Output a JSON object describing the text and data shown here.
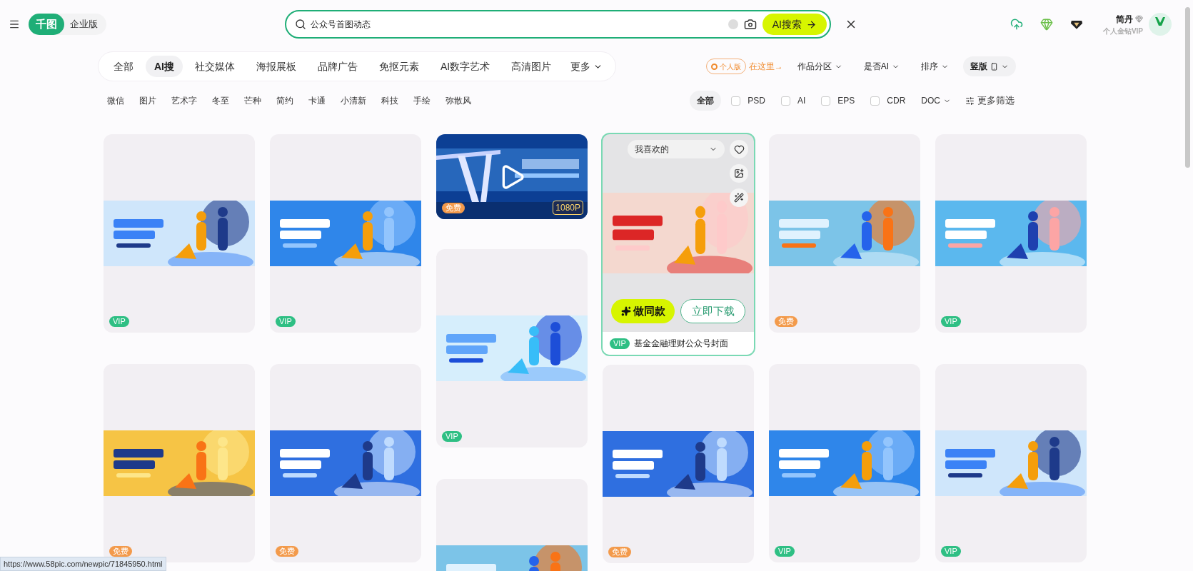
{
  "header": {
    "logo": "千图",
    "edition": "企业版",
    "search": {
      "value": "公众号首图动态"
    },
    "ai_search_button": "AI搜索",
    "user": {
      "name": "简丹",
      "level": "个人金钻VIP"
    }
  },
  "categories": [
    {
      "label": "全部",
      "selected": false
    },
    {
      "label": "AI搜",
      "selected": true
    },
    {
      "label": "社交媒体",
      "selected": false
    },
    {
      "label": "海报展板",
      "selected": false
    },
    {
      "label": "品牌广告",
      "selected": false
    },
    {
      "label": "免抠元素",
      "selected": false
    },
    {
      "label": "AI数字艺术",
      "selected": false
    },
    {
      "label": "高清图片",
      "selected": false
    }
  ],
  "category_more": "更多",
  "promo": {
    "badge": "个人版",
    "text": "在这里→"
  },
  "sort_filters": [
    {
      "label": "作品分区",
      "selected": false
    },
    {
      "label": "是否AI",
      "selected": false
    },
    {
      "label": "排序",
      "selected": false
    },
    {
      "label": "竖版",
      "selected": true
    }
  ],
  "tags": [
    "微信",
    "图片",
    "艺术字",
    "冬至",
    "芒种",
    "简约",
    "卡通",
    "小清新",
    "科技",
    "手绘",
    "弥散风"
  ],
  "format_filters": [
    {
      "kind": "pill",
      "label": "全部",
      "selected": true
    },
    {
      "kind": "checkbox",
      "label": "PSD",
      "checked": false
    },
    {
      "kind": "checkbox",
      "label": "AI",
      "checked": false
    },
    {
      "kind": "checkbox",
      "label": "EPS",
      "checked": false
    },
    {
      "kind": "checkbox",
      "label": "CDR",
      "checked": false
    },
    {
      "kind": "dropdown",
      "label": "DOC"
    },
    {
      "kind": "more",
      "label": "更多筛选"
    }
  ],
  "columns": [
    [
      {
        "kind": "template",
        "badge": {
          "text": "VIP",
          "color": "#2fbf84"
        }
      },
      {
        "kind": "template",
        "badge": {
          "text": "免费",
          "color": "#f39a4b"
        }
      }
    ],
    [
      {
        "kind": "template",
        "badge": {
          "text": "VIP",
          "color": "#2fbf84"
        }
      },
      {
        "kind": "template",
        "badge": {
          "text": "免费",
          "color": "#f39a4b"
        }
      }
    ],
    [
      {
        "kind": "video",
        "badge": {
          "text": "免费",
          "color": "#f39a4b"
        },
        "resolution": "1080P"
      },
      {
        "kind": "template",
        "badge": {
          "text": "VIP",
          "color": "#2fbf84"
        }
      },
      {
        "kind": "template"
      }
    ],
    [
      {
        "kind": "hover",
        "badge": {
          "text": "VIP",
          "color": "#2fbf84"
        },
        "title": "基金金融理财公众号封面",
        "favorite_dropdown": "我喜欢的",
        "actions": [
          "做同款",
          "立即下载"
        ]
      },
      {
        "kind": "template",
        "badge": {
          "text": "免费",
          "color": "#f39a4b"
        }
      }
    ],
    [
      {
        "kind": "template",
        "badge": {
          "text": "免费",
          "color": "#f39a4b"
        }
      },
      {
        "kind": "template",
        "badge": {
          "text": "VIP",
          "color": "#2fbf84"
        }
      }
    ],
    [
      {
        "kind": "template",
        "badge": {
          "text": "VIP",
          "color": "#2fbf84"
        }
      },
      {
        "kind": "template",
        "badge": {
          "text": "VIP",
          "color": "#2fbf84"
        }
      }
    ]
  ],
  "status_url": "https://www.58pic.com/newpic/71845950.html"
}
